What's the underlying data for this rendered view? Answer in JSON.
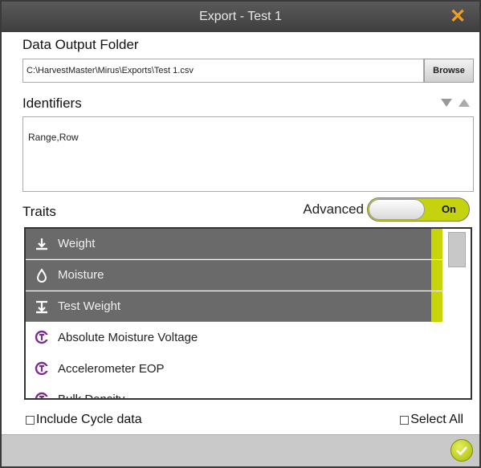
{
  "window": {
    "title": "Export - Test 1"
  },
  "output_folder": {
    "label": "Data Output Folder",
    "path_value": "C:\\HarvestMaster\\Mirus\\Exports\\Test 1.csv",
    "browse_label": "Browse"
  },
  "identifiers": {
    "label": "Identifiers",
    "value": "Range,Row"
  },
  "traits": {
    "label": "Traits",
    "advanced_label": "Advanced",
    "toggle_state": "On",
    "items": [
      {
        "label": "Weight",
        "icon": "weight-icon",
        "selected": true
      },
      {
        "label": "Moisture",
        "icon": "drop-icon",
        "selected": true
      },
      {
        "label": "Test Weight",
        "icon": "test-weight-icon",
        "selected": true
      },
      {
        "label": "Absolute Moisture Voltage",
        "icon": "calculated-trait-icon",
        "selected": false
      },
      {
        "label": "Accelerometer EOP",
        "icon": "calculated-trait-icon",
        "selected": false
      },
      {
        "label": "Bulk Density",
        "icon": "calculated-trait-icon",
        "selected": false
      }
    ]
  },
  "options": {
    "include_cycle_label": "Include Cycle data",
    "select_all_label": "Select All"
  },
  "colors": {
    "accent": "#c8d40a",
    "titlebar": "#4a4a4a",
    "selected_row": "#6a6a6a",
    "close": "#f0a020",
    "trait_icon": "#7b2d8e"
  }
}
